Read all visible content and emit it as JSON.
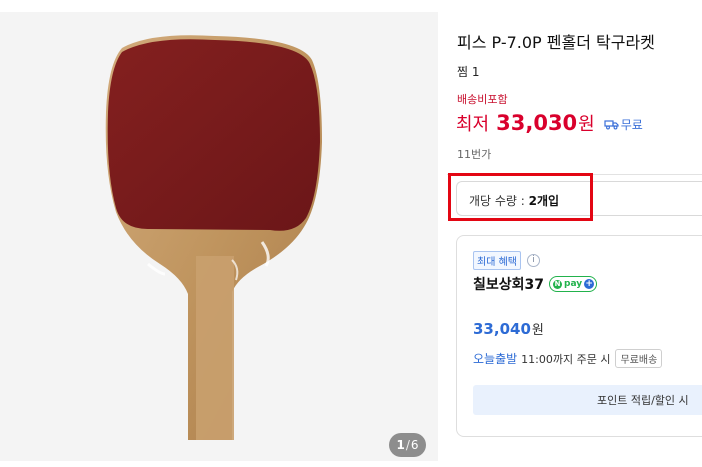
{
  "product": {
    "title": "피스 P-7.0P 펜홀더 탁구라켓",
    "wish_count": "찜 1",
    "shipping_note": "배송비포함",
    "price_prefix": "최저",
    "price_value": "33,030",
    "price_unit": "원",
    "free_shipping_label": "무료",
    "seller": "11번가"
  },
  "gallery": {
    "current_page": "1",
    "total_pages": "6",
    "separator": "/"
  },
  "option": {
    "label": "개당 수량 : ",
    "value": "2개입"
  },
  "offer": {
    "badge": "최대 혜택",
    "info_icon_glyph": "i",
    "store_name": "칠보상회37",
    "npay_n": "N",
    "npay_label": "pay",
    "npay_plus": "+",
    "price_value": "33,040",
    "price_unit": "원",
    "delivery_today": "오늘출발",
    "delivery_detail": "11:00까지 주문 시",
    "free_delivery_tag": "무료배송",
    "points_button_label": "포인트 적립/할인 시"
  },
  "icons": {
    "truck": "truck-icon",
    "info": "info-icon",
    "npay": "npay-logo-icon"
  },
  "colors": {
    "price_red": "#d9002c",
    "accent_blue": "#2d6bd5",
    "highlight_red": "#e30613",
    "npay_green": "#22b24c",
    "paddle_rubber": "#7a1a1c",
    "paddle_wood": "#c39a6b"
  }
}
